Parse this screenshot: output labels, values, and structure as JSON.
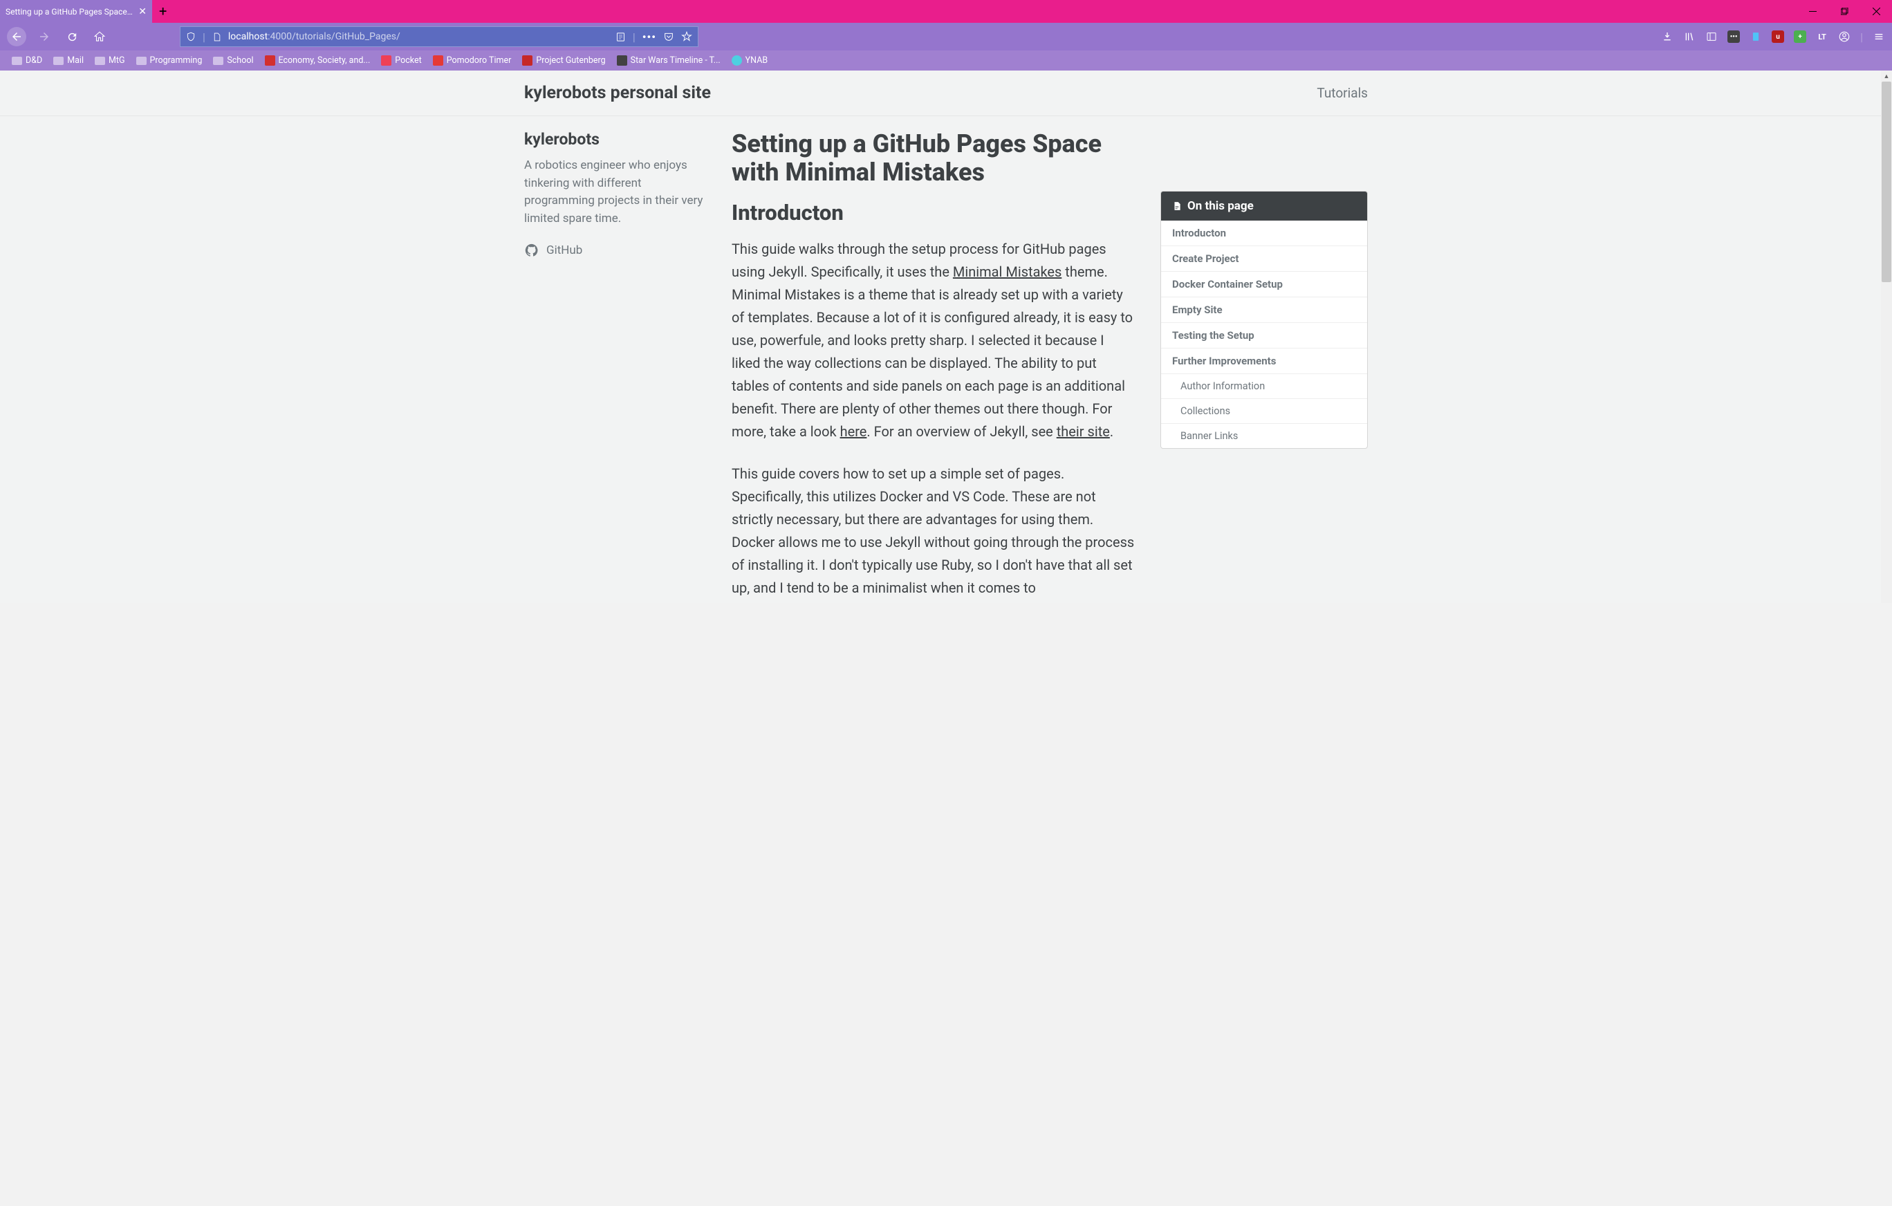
{
  "browser": {
    "tab_title": "Setting up a GitHub Pages Space w",
    "url_host": "localhost",
    "url_port": ":4000",
    "url_path": "/tutorials/GitHub_Pages/"
  },
  "bookmarks": [
    {
      "label": "D&D",
      "type": "folder"
    },
    {
      "label": "Mail",
      "type": "folder"
    },
    {
      "label": "MtG",
      "type": "folder"
    },
    {
      "label": "Programming",
      "type": "folder"
    },
    {
      "label": "School",
      "type": "folder"
    },
    {
      "label": "Economy, Society, and...",
      "type": "icon",
      "color": "#d32f2f"
    },
    {
      "label": "Pocket",
      "type": "icon",
      "color": "#ef4056"
    },
    {
      "label": "Pomodoro Timer",
      "type": "icon",
      "color": "#e53935"
    },
    {
      "label": "Project Gutenberg",
      "type": "icon",
      "color": "#c62828"
    },
    {
      "label": "Star Wars Timeline - T...",
      "type": "icon",
      "color": "#424242"
    },
    {
      "label": "YNAB",
      "type": "icon",
      "color": "#4dd0e1"
    }
  ],
  "site": {
    "title": "kylerobots personal site",
    "nav": "Tutorials"
  },
  "author": {
    "name": "kylerobots",
    "bio": "A robotics engineer who enjoys tinkering with different programming projects in their very limited spare time.",
    "github": "GitHub"
  },
  "article": {
    "title": "Setting up a GitHub Pages Space with Minimal Mistakes",
    "h2": "Introducton",
    "p1_a": "This guide walks through the setup process for GitHub pages using Jekyll. Specifically, it uses the ",
    "p1_link1": "Minimal Mistakes",
    "p1_b": " theme. Minimal Mistakes is a theme that is already set up with a variety of templates. Because a lot of it is configured already, it is easy to use, powerfule, and looks pretty sharp. I selected it because I liked the way collections can be displayed. The ability to put tables of contents and side panels on each page is an additional benefit. There are plenty of other themes out there though. For more, take a look ",
    "p1_link2": "here",
    "p1_c": ". For an overview of Jekyll, see ",
    "p1_link3": "their site",
    "p1_d": ".",
    "p2": "This guide covers how to set up a simple set of pages. Specifically, this utilizes Docker and VS Code. These are not strictly necessary, but there are advantages for using them. Docker allows me to use Jekyll without going through the process of installing it. I don't typically use Ruby, so I don't have that all set up, and I tend to be a minimalist when it comes to"
  },
  "toc": {
    "header": "On this page",
    "items": [
      {
        "label": "Introducton",
        "sub": false
      },
      {
        "label": "Create Project",
        "sub": false
      },
      {
        "label": "Docker Container Setup",
        "sub": false
      },
      {
        "label": "Empty Site",
        "sub": false
      },
      {
        "label": "Testing the Setup",
        "sub": false
      },
      {
        "label": "Further Improvements",
        "sub": false
      },
      {
        "label": "Author Information",
        "sub": true
      },
      {
        "label": "Collections",
        "sub": true
      },
      {
        "label": "Banner Links",
        "sub": true
      }
    ]
  }
}
